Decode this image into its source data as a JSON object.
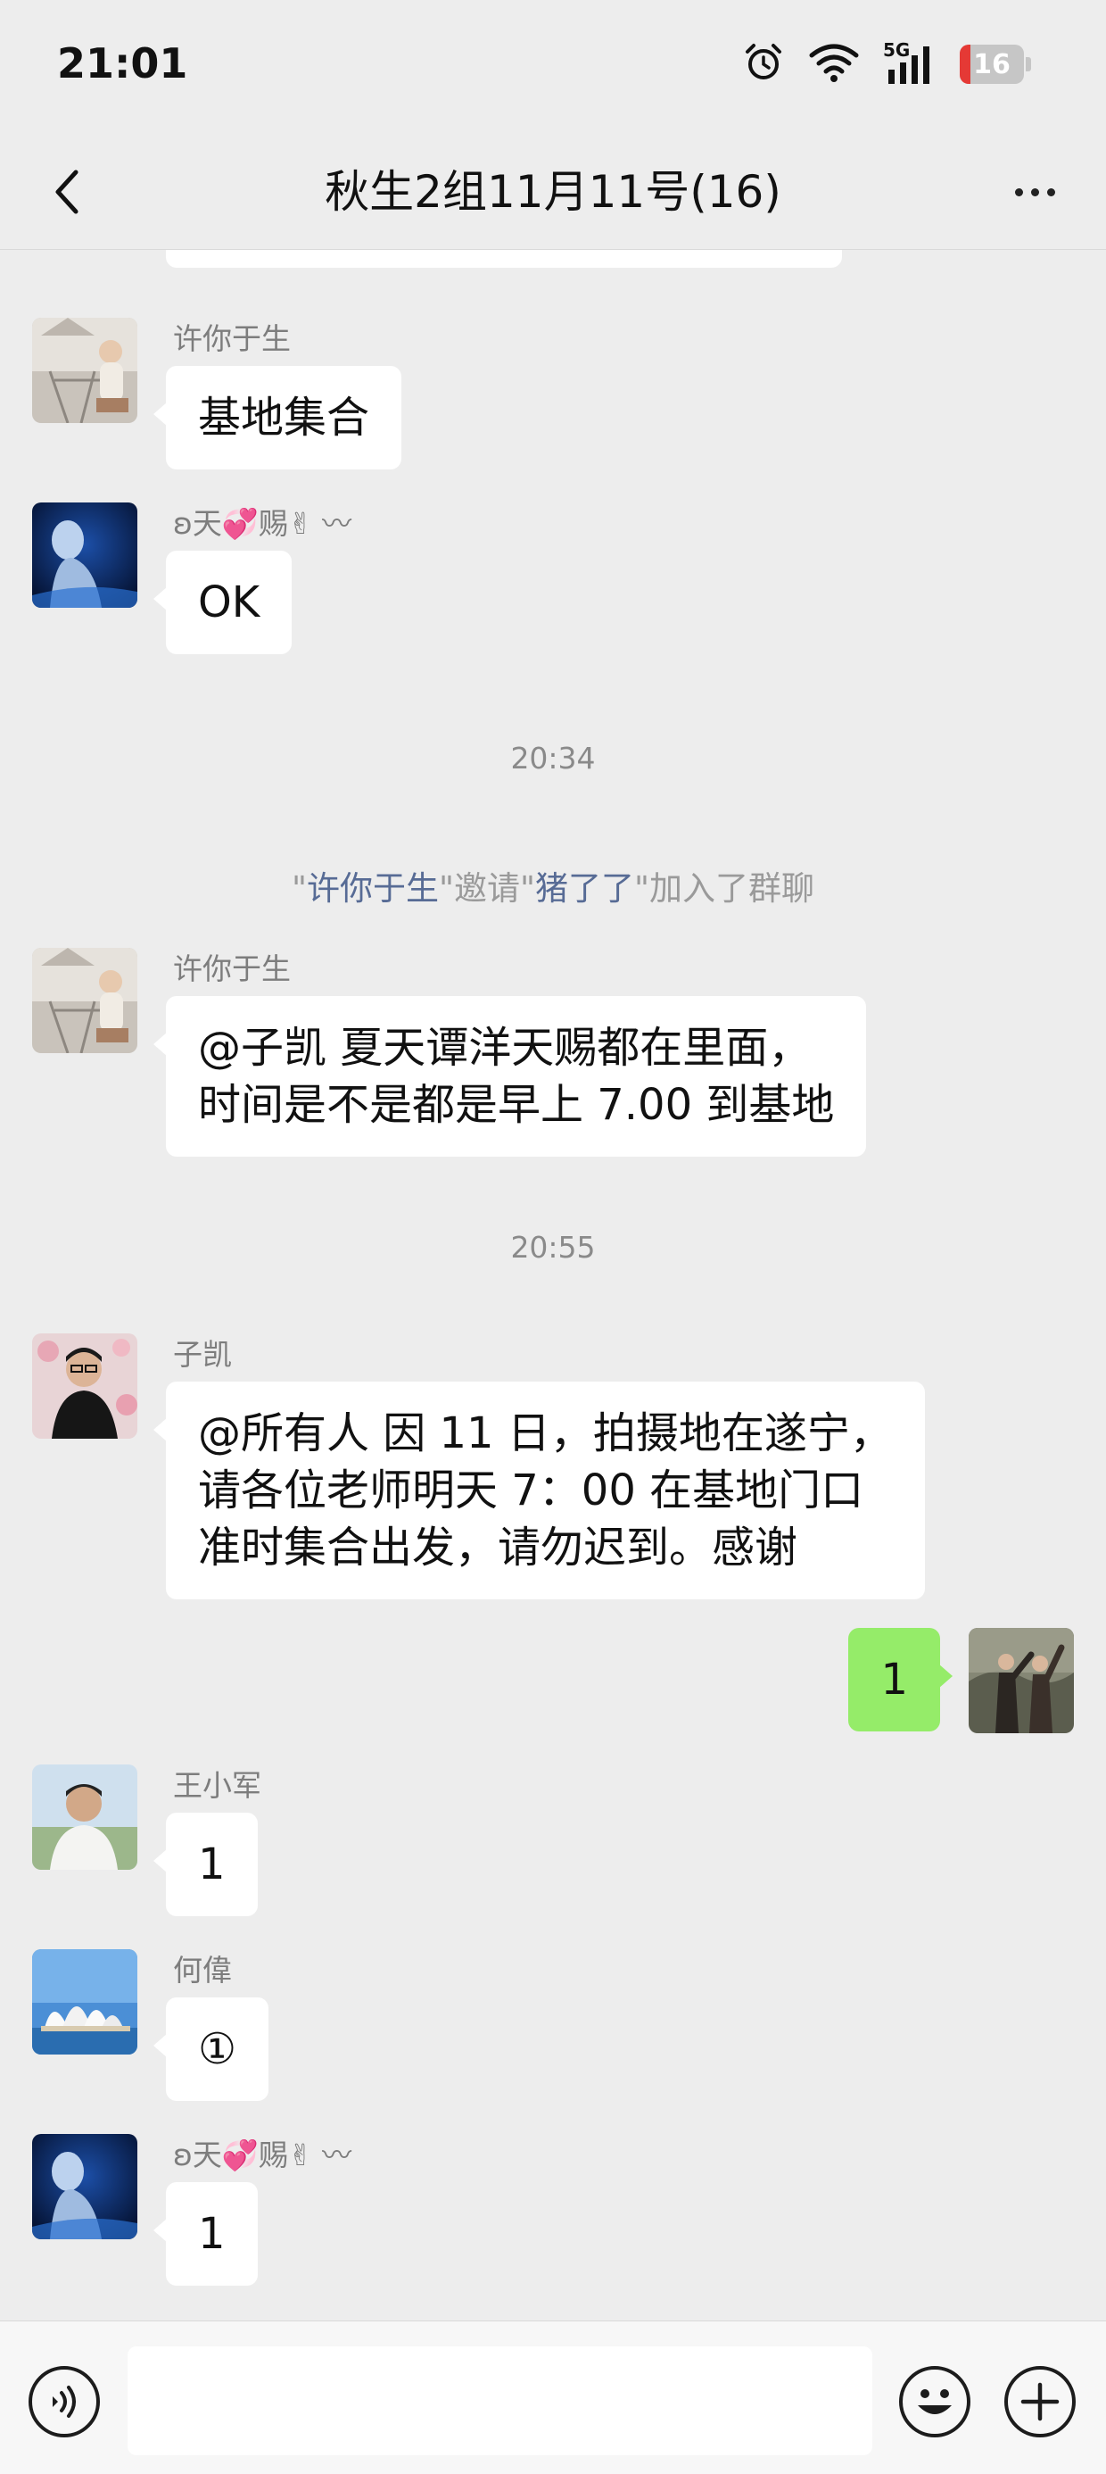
{
  "status_bar": {
    "time": "21:01",
    "network": "5G",
    "battery": "16"
  },
  "nav": {
    "title": "秋生2组11月11号(16)"
  },
  "messages": [
    {
      "sender": "许你于生",
      "text": "基地集合"
    },
    {
      "sender": "ʚ天💞赐✌ 〰",
      "text": "OK"
    },
    {
      "timestamp": "20:34"
    },
    {
      "system": {
        "q1": "\"",
        "inviter": "许你于生",
        "mid": "\"邀请\"",
        "invitee": "猪了了",
        "tail": "\"加入了群聊"
      }
    },
    {
      "sender": "许你于生",
      "lines": [
        "@子凯  夏天谭洋天赐都在里面，",
        "时间是不是都是早上 7.00 到基地"
      ]
    },
    {
      "timestamp": "20:55"
    },
    {
      "sender": "子凯",
      "lines": [
        "@所有人  因 11 日，拍摄地在遂宁，",
        "请各位老师明天 7：00 在基地门口",
        "准时集合出发，请勿迟到。感谢"
      ]
    },
    {
      "self": true,
      "text": "1"
    },
    {
      "sender": "王小军",
      "text": "1"
    },
    {
      "sender": "何偉",
      "text": "①"
    },
    {
      "sender": "ʚ天💞赐✌ 〰",
      "text": "1"
    }
  ],
  "colors": {
    "background": "#ededed",
    "self_bubble": "#95ec69",
    "other_bubble": "#ffffff",
    "link": "#576b95"
  }
}
